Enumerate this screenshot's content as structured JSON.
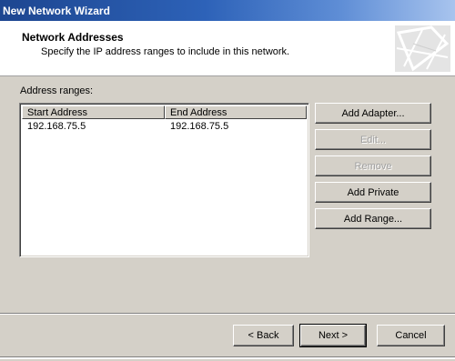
{
  "window": {
    "title": "New Network Wizard"
  },
  "header": {
    "title": "Network Addresses",
    "subtitle": "Specify the IP address ranges to include in this network."
  },
  "address_ranges": {
    "label": "Address ranges:",
    "columns": [
      "Start Address",
      "End Address"
    ],
    "rows": [
      {
        "start": "192.168.75.5",
        "end": "192.168.75.5"
      }
    ]
  },
  "side_buttons": {
    "add_adapter": "Add Adapter...",
    "edit": "Edit...",
    "remove": "Remove",
    "add_private": "Add Private",
    "add_range": "Add Range..."
  },
  "footer": {
    "back": "< Back",
    "next": "Next >",
    "cancel": "Cancel"
  }
}
